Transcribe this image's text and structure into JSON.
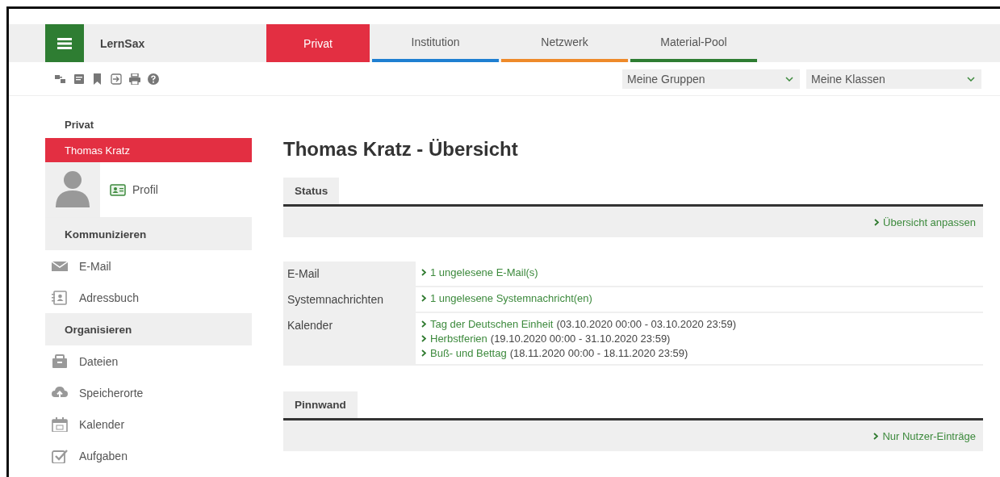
{
  "header": {
    "app_name": "LernSax",
    "tabs": [
      {
        "label": "Privat",
        "selected": true,
        "color": "#e32f42"
      },
      {
        "label": "Institution",
        "selected": false,
        "color": "#1f7fd1"
      },
      {
        "label": "Netzwerk",
        "selected": false,
        "color": "#ee8a2a"
      },
      {
        "label": "Material-Pool",
        "selected": false,
        "color": "#2e7d32"
      }
    ],
    "dropdowns": [
      {
        "value": "Meine Gruppen"
      },
      {
        "value": "Meine Klassen"
      }
    ]
  },
  "sidebar": {
    "title": "Privat",
    "items": [
      {
        "kind": "user",
        "label": "Thomas Kratz",
        "selected": true
      },
      {
        "kind": "profile",
        "label": "Profil"
      },
      {
        "kind": "section",
        "label": "Kommunizieren"
      },
      {
        "kind": "link",
        "label": "E-Mail"
      },
      {
        "kind": "link",
        "label": "Adressbuch"
      },
      {
        "kind": "section",
        "label": "Organisieren"
      },
      {
        "kind": "link",
        "label": "Dateien"
      },
      {
        "kind": "link",
        "label": "Speicherorte"
      },
      {
        "kind": "link",
        "label": "Kalender"
      },
      {
        "kind": "link",
        "label": "Aufgaben"
      }
    ]
  },
  "main": {
    "title": "Thomas Kratz - Übersicht",
    "status": {
      "tab": "Status",
      "action": "Übersicht anpassen",
      "rows": [
        {
          "label": "E-Mail",
          "entries": [
            {
              "link": "1 ungelesene E-Mail(s)"
            }
          ]
        },
        {
          "label": "Systemnachrichten",
          "entries": [
            {
              "link": "1 ungelesene Systemnachricht(en)"
            }
          ]
        },
        {
          "label": "Kalender",
          "entries": [
            {
              "link": "Tag der Deutschen Einheit",
              "detail": "(03.10.2020 00:00 - 03.10.2020 23:59)"
            },
            {
              "link": "Herbstferien",
              "detail": "(19.10.2020 00:00 - 31.10.2020 23:59)"
            },
            {
              "link": "Buß- und Bettag",
              "detail": "(18.11.2020 00:00 - 18.11.2020 23:59)"
            }
          ]
        }
      ]
    },
    "pinnwand": {
      "tab": "Pinnwand",
      "action": "Nur Nutzer-Einträge"
    }
  }
}
